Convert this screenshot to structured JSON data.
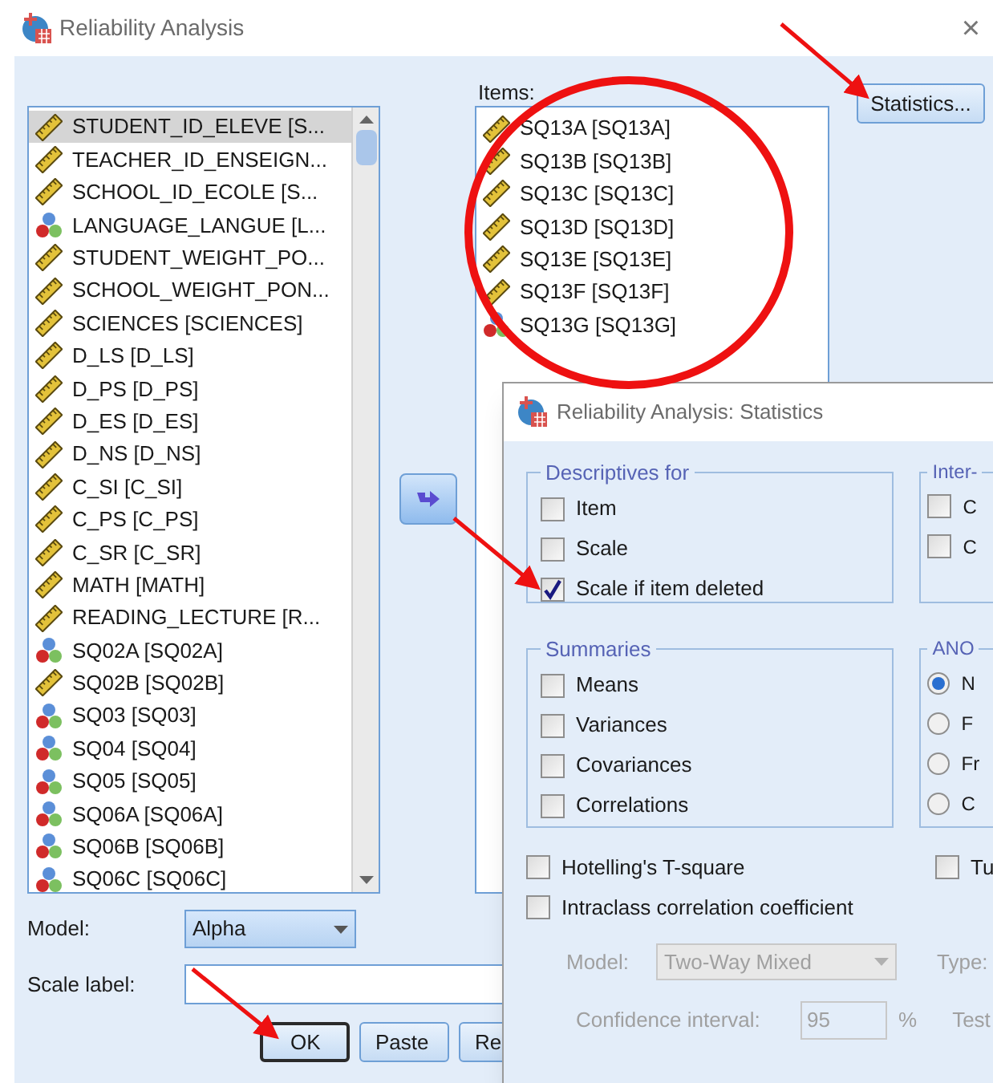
{
  "window": {
    "title": "Reliability Analysis",
    "close": "×"
  },
  "variables": [
    {
      "label": "STUDENT_ID_ELEVE [S...",
      "kind": "scale",
      "selected": true
    },
    {
      "label": "TEACHER_ID_ENSEIGN...",
      "kind": "scale",
      "selected": false
    },
    {
      "label": "SCHOOL_ID_ECOLE [S...",
      "kind": "scale",
      "selected": false
    },
    {
      "label": "LANGUAGE_LANGUE [L...",
      "kind": "nominal",
      "selected": false
    },
    {
      "label": "STUDENT_WEIGHT_PO...",
      "kind": "scale",
      "selected": false
    },
    {
      "label": "SCHOOL_WEIGHT_PON...",
      "kind": "scale",
      "selected": false
    },
    {
      "label": "SCIENCES [SCIENCES]",
      "kind": "scale",
      "selected": false
    },
    {
      "label": "D_LS [D_LS]",
      "kind": "scale",
      "selected": false
    },
    {
      "label": "D_PS [D_PS]",
      "kind": "scale",
      "selected": false
    },
    {
      "label": "D_ES [D_ES]",
      "kind": "scale",
      "selected": false
    },
    {
      "label": "D_NS [D_NS]",
      "kind": "scale",
      "selected": false
    },
    {
      "label": "C_SI [C_SI]",
      "kind": "scale",
      "selected": false
    },
    {
      "label": "C_PS [C_PS]",
      "kind": "scale",
      "selected": false
    },
    {
      "label": "C_SR [C_SR]",
      "kind": "scale",
      "selected": false
    },
    {
      "label": "MATH [MATH]",
      "kind": "scale",
      "selected": false
    },
    {
      "label": "READING_LECTURE [R...",
      "kind": "scale",
      "selected": false
    },
    {
      "label": "SQ02A [SQ02A]",
      "kind": "nominal",
      "selected": false
    },
    {
      "label": "SQ02B [SQ02B]",
      "kind": "scale",
      "selected": false
    },
    {
      "label": "SQ03 [SQ03]",
      "kind": "nominal",
      "selected": false
    },
    {
      "label": "SQ04 [SQ04]",
      "kind": "nominal",
      "selected": false
    },
    {
      "label": "SQ05 [SQ05]",
      "kind": "nominal",
      "selected": false
    },
    {
      "label": "SQ06A [SQ06A]",
      "kind": "nominal",
      "selected": false
    },
    {
      "label": "SQ06B [SQ06B]",
      "kind": "nominal",
      "selected": false
    },
    {
      "label": "SQ06C [SQ06C]",
      "kind": "nominal",
      "selected": false
    }
  ],
  "items_label": "Items:",
  "items": [
    {
      "label": "SQ13A [SQ13A]",
      "kind": "scale",
      "selected": false
    },
    {
      "label": "SQ13B [SQ13B]",
      "kind": "scale",
      "selected": false
    },
    {
      "label": "SQ13C [SQ13C]",
      "kind": "scale",
      "selected": false
    },
    {
      "label": "SQ13D [SQ13D]",
      "kind": "scale",
      "selected": false
    },
    {
      "label": "SQ13E [SQ13E]",
      "kind": "scale",
      "selected": false
    },
    {
      "label": "SQ13F [SQ13F]",
      "kind": "scale",
      "selected": false
    },
    {
      "label": "SQ13G [SQ13G]",
      "kind": "nominal",
      "selected": false
    }
  ],
  "statistics_button": {
    "label": "Statistics..."
  },
  "model": {
    "label": "Model:",
    "value": "Alpha"
  },
  "scale_label": {
    "label": "Scale label:"
  },
  "buttons": [
    {
      "label": "OK",
      "default": true
    },
    {
      "label": "Paste",
      "default": false
    },
    {
      "label": "Re",
      "default": false
    }
  ],
  "statistics_dialog": {
    "title": "Reliability Analysis: Statistics",
    "groups": [
      {
        "title": "Descriptives for",
        "options": [
          {
            "label": "Item",
            "kind": "checkbox",
            "checked": false
          },
          {
            "label": "Scale",
            "kind": "checkbox",
            "checked": false
          },
          {
            "label": "Scale if item deleted",
            "kind": "checkbox",
            "checked": true
          }
        ]
      },
      {
        "title": "Inter-",
        "options": [
          {
            "label": "C",
            "kind": "checkbox",
            "checked": false
          },
          {
            "label": "C",
            "kind": "checkbox",
            "checked": false
          }
        ]
      },
      {
        "title": "Summaries",
        "options": [
          {
            "label": "Means",
            "kind": "checkbox",
            "checked": false
          },
          {
            "label": "Variances",
            "kind": "checkbox",
            "checked": false
          },
          {
            "label": "Covariances",
            "kind": "checkbox",
            "checked": false
          },
          {
            "label": "Correlations",
            "kind": "checkbox",
            "checked": false
          }
        ]
      },
      {
        "title": "ANO",
        "options": [
          {
            "label": "N",
            "kind": "radio",
            "selected": true
          },
          {
            "label": "F",
            "kind": "radio",
            "selected": false
          },
          {
            "label": "Fr",
            "kind": "radio",
            "selected": false
          },
          {
            "label": "C",
            "kind": "radio",
            "selected": false
          }
        ]
      }
    ],
    "options_left": [
      {
        "label": "Hotelling's T-square",
        "checked": false
      },
      {
        "label": "Intraclass correlation coefficient",
        "checked": false
      }
    ],
    "options_right": [
      {
        "label": "Tu",
        "checked": false
      }
    ],
    "icc": {
      "disabled": true,
      "model_label": "Model:",
      "model_value": "Two-Way Mixed",
      "type_label": "Type:",
      "ci_label": "Confidence interval:",
      "ci_value": "95",
      "percent": "%",
      "test_label": "Test"
    }
  }
}
